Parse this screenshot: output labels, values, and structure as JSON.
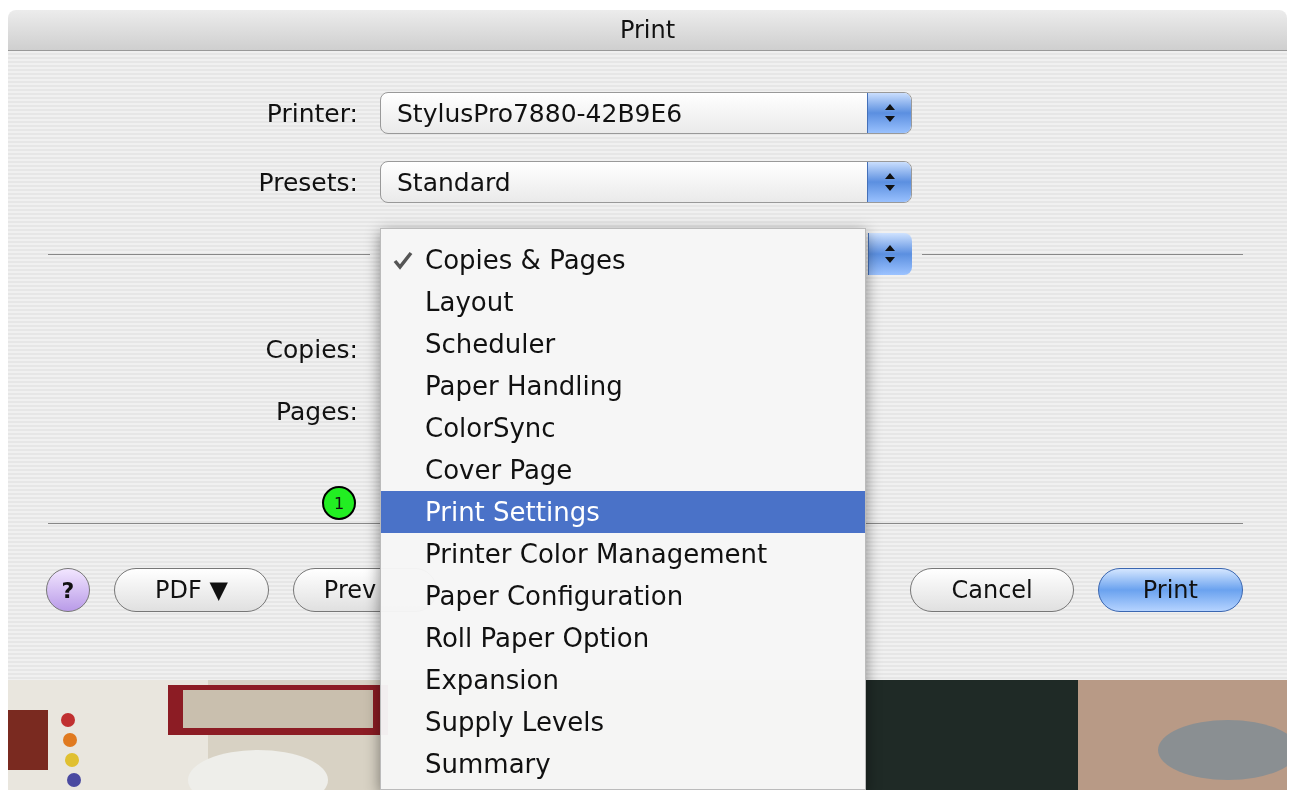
{
  "window": {
    "title": "Print"
  },
  "fields": [
    {
      "label": "Printer:",
      "value": "StylusPro7880-42B9E6"
    },
    {
      "label": "Presets:",
      "value": "Standard"
    }
  ],
  "panel_labels": [
    "Copies:",
    "Pages:"
  ],
  "callout": "1",
  "menu": [
    {
      "label": "Copies & Pages",
      "checked": true,
      "selected": false
    },
    {
      "label": "Layout",
      "checked": false,
      "selected": false
    },
    {
      "label": "Scheduler",
      "checked": false,
      "selected": false
    },
    {
      "label": "Paper Handling",
      "checked": false,
      "selected": false
    },
    {
      "label": "ColorSync",
      "checked": false,
      "selected": false
    },
    {
      "label": "Cover Page",
      "checked": false,
      "selected": false
    },
    {
      "label": "Print Settings",
      "checked": false,
      "selected": true
    },
    {
      "label": "Printer Color Management",
      "checked": false,
      "selected": false
    },
    {
      "label": "Paper Configuration",
      "checked": false,
      "selected": false
    },
    {
      "label": "Roll Paper Option",
      "checked": false,
      "selected": false
    },
    {
      "label": "Expansion",
      "checked": false,
      "selected": false
    },
    {
      "label": "Supply Levels",
      "checked": false,
      "selected": false
    },
    {
      "label": "Summary",
      "checked": false,
      "selected": false
    }
  ],
  "left_buttons": [
    {
      "kind": "help",
      "label": "?"
    },
    {
      "kind": "normal",
      "label": "PDF ▼"
    },
    {
      "kind": "cut",
      "label": "Prev"
    }
  ],
  "right_buttons": [
    {
      "kind": "normal",
      "label": "Cancel"
    },
    {
      "kind": "default",
      "label": "Print"
    }
  ],
  "background": {
    "kind": "picture"
  }
}
